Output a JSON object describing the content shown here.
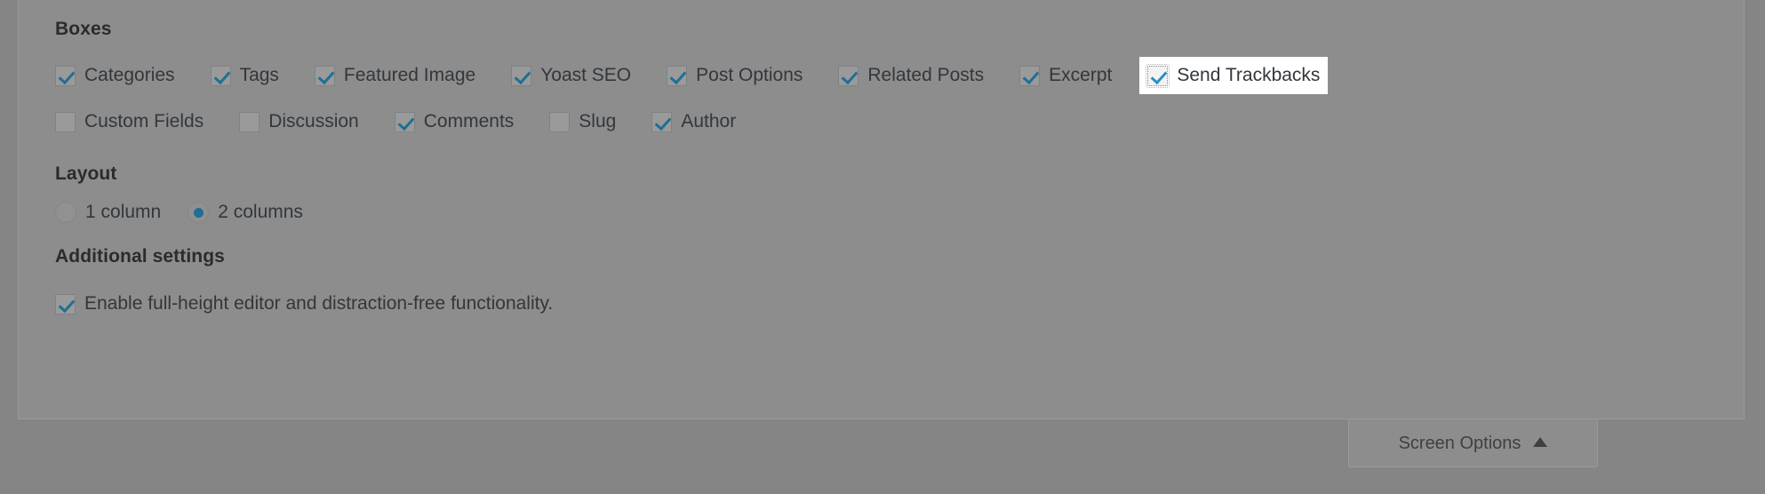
{
  "panel": {
    "boxes": {
      "heading": "Boxes",
      "row_one": [
        {
          "label": "Categories",
          "checked": true,
          "highlighted": false
        },
        {
          "label": "Tags",
          "checked": true,
          "highlighted": false
        },
        {
          "label": "Featured Image",
          "checked": true,
          "highlighted": false
        },
        {
          "label": "Yoast SEO",
          "checked": true,
          "highlighted": false
        },
        {
          "label": "Post Options",
          "checked": true,
          "highlighted": false
        },
        {
          "label": "Related Posts",
          "checked": true,
          "highlighted": false
        },
        {
          "label": "Excerpt",
          "checked": true,
          "highlighted": false
        },
        {
          "label": "Send Trackbacks",
          "checked": true,
          "highlighted": true
        }
      ],
      "row_two": [
        {
          "label": "Custom Fields",
          "checked": false,
          "highlighted": false
        },
        {
          "label": "Discussion",
          "checked": false,
          "highlighted": false
        },
        {
          "label": "Comments",
          "checked": true,
          "highlighted": false
        },
        {
          "label": "Slug",
          "checked": false,
          "highlighted": false
        },
        {
          "label": "Author",
          "checked": true,
          "highlighted": false
        }
      ]
    },
    "layout": {
      "heading": "Layout",
      "options": [
        {
          "label": "1 column",
          "selected": false
        },
        {
          "label": "2 columns",
          "selected": true
        }
      ]
    },
    "additional": {
      "heading": "Additional settings",
      "option": {
        "label": "Enable full-height editor and distraction-free functionality.",
        "checked": true
      }
    }
  },
  "screen_options_tab": {
    "label": "Screen Options",
    "caret": "caret-up-icon"
  },
  "colors": {
    "overlay_background": "#858585",
    "panel_background": "#8d8d8d",
    "panel_border": "#9b9b9b",
    "accent_blue": "#1f6f94",
    "highlight_background": "#ffffff",
    "text": "#32373c",
    "heading_text": "#2b2b2b"
  }
}
